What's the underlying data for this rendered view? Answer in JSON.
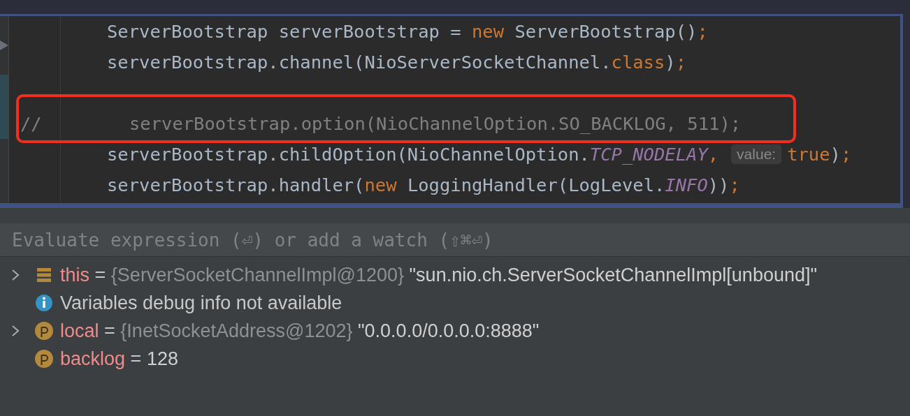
{
  "editor": {
    "lines": [
      {
        "kind": "code",
        "highlighted": false,
        "tokens": [
          {
            "text": "ServerBootstrap serverBootstrap = ",
            "kind": "plain"
          },
          {
            "text": "new",
            "kind": "keyword"
          },
          {
            "text": " ServerBootstrap()",
            "kind": "plain"
          },
          {
            "text": ";",
            "kind": "keyword"
          }
        ]
      },
      {
        "kind": "code",
        "highlighted": false,
        "tokens": [
          {
            "text": "serverBootstrap.channel(NioServerSocketChannel.",
            "kind": "plain"
          },
          {
            "text": "class",
            "kind": "keyword"
          },
          {
            "text": ")",
            "kind": "plain"
          },
          {
            "text": ";",
            "kind": "keyword"
          }
        ]
      },
      {
        "kind": "blank",
        "highlighted": false
      },
      {
        "kind": "commented",
        "highlighted": true,
        "marker": "//",
        "tokens": [
          {
            "text": "serverBootstrap.option(NioChannelOption.SO_BACKLOG, 511);",
            "kind": "comment"
          }
        ]
      },
      {
        "kind": "code",
        "highlighted": false,
        "tokens": [
          {
            "text": "serverBootstrap.childOption(NioChannelOption.",
            "kind": "plain"
          },
          {
            "text": "TCP_NODELAY",
            "kind": "static"
          },
          {
            "text": ",",
            "kind": "keyword"
          },
          {
            "text": "value:",
            "kind": "hint"
          },
          {
            "text": "true",
            "kind": "keyword"
          },
          {
            "text": ")",
            "kind": "plain"
          },
          {
            "text": ";",
            "kind": "keyword"
          }
        ]
      },
      {
        "kind": "code",
        "highlighted": false,
        "tokens": [
          {
            "text": "serverBootstrap.handler(",
            "kind": "plain"
          },
          {
            "text": "new",
            "kind": "keyword"
          },
          {
            "text": " LoggingHandler(LogLevel.",
            "kind": "plain"
          },
          {
            "text": "INFO",
            "kind": "static"
          },
          {
            "text": "))",
            "kind": "plain"
          },
          {
            "text": ";",
            "kind": "keyword"
          }
        ]
      }
    ]
  },
  "evaluate": {
    "placeholder": "Evaluate expression (⏎) or add a watch (⇧⌘⏎)"
  },
  "variables": [
    {
      "expandable": true,
      "kind": "object",
      "name": "this",
      "separator": "=",
      "type": "{ServerSocketChannelImpl@1200}",
      "value": "\"sun.nio.ch.ServerSocketChannelImpl[unbound]\""
    },
    {
      "expandable": false,
      "kind": "info",
      "message": "Variables debug info not available"
    },
    {
      "expandable": true,
      "kind": "parameter",
      "name": "local",
      "separator": "=",
      "type": "{InetSocketAddress@1202}",
      "value": "\"0.0.0.0/0.0.0.0:8888\""
    },
    {
      "expandable": false,
      "kind": "parameter",
      "name": "backlog",
      "separator": "=",
      "value": "128"
    }
  ]
}
